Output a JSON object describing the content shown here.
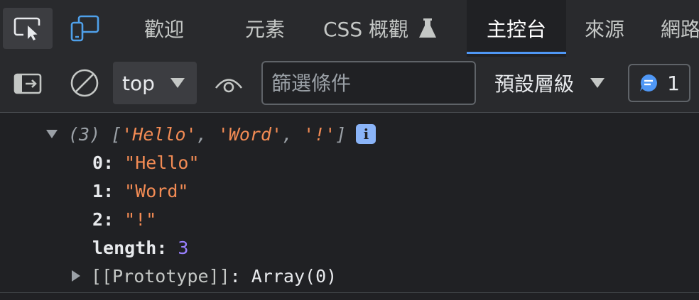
{
  "tabs": [
    {
      "label": "歡迎"
    },
    {
      "label": "元素"
    },
    {
      "label": "CSS 概觀"
    },
    {
      "label": "主控台",
      "active": true
    },
    {
      "label": "來源"
    },
    {
      "label": "網路"
    }
  ],
  "icons": {
    "inspect": "inspect-element-icon",
    "device": "device-emulation-icon",
    "flask": "experimental-flask-icon",
    "sidebar": "show-sidebar-icon",
    "clear": "clear-console-icon",
    "eye": "live-expression-eye-icon",
    "message": "issues-message-icon"
  },
  "toolbar": {
    "context": "top",
    "filter_placeholder": "篩選條件",
    "filter_value": "",
    "levels": "預設層級",
    "issues_count": "1"
  },
  "console": {
    "summary": {
      "count": "(3)",
      "open": "[",
      "items": [
        "'Hello'",
        "'Word'",
        "'!'"
      ],
      "close": "]",
      "info": "i"
    },
    "props": [
      {
        "key": "0",
        "value": "\"Hello\""
      },
      {
        "key": "1",
        "value": "\"Word\""
      },
      {
        "key": "2",
        "value": "\"!\""
      }
    ],
    "length": {
      "key": "length",
      "value": "3"
    },
    "prototype": {
      "key": "[[Prototype]]",
      "value": "Array(0)"
    }
  },
  "colors": {
    "accent": "#4f97f5",
    "string": "#f28b54",
    "number": "#9980ff",
    "info_badge": "#8ab4f8"
  }
}
